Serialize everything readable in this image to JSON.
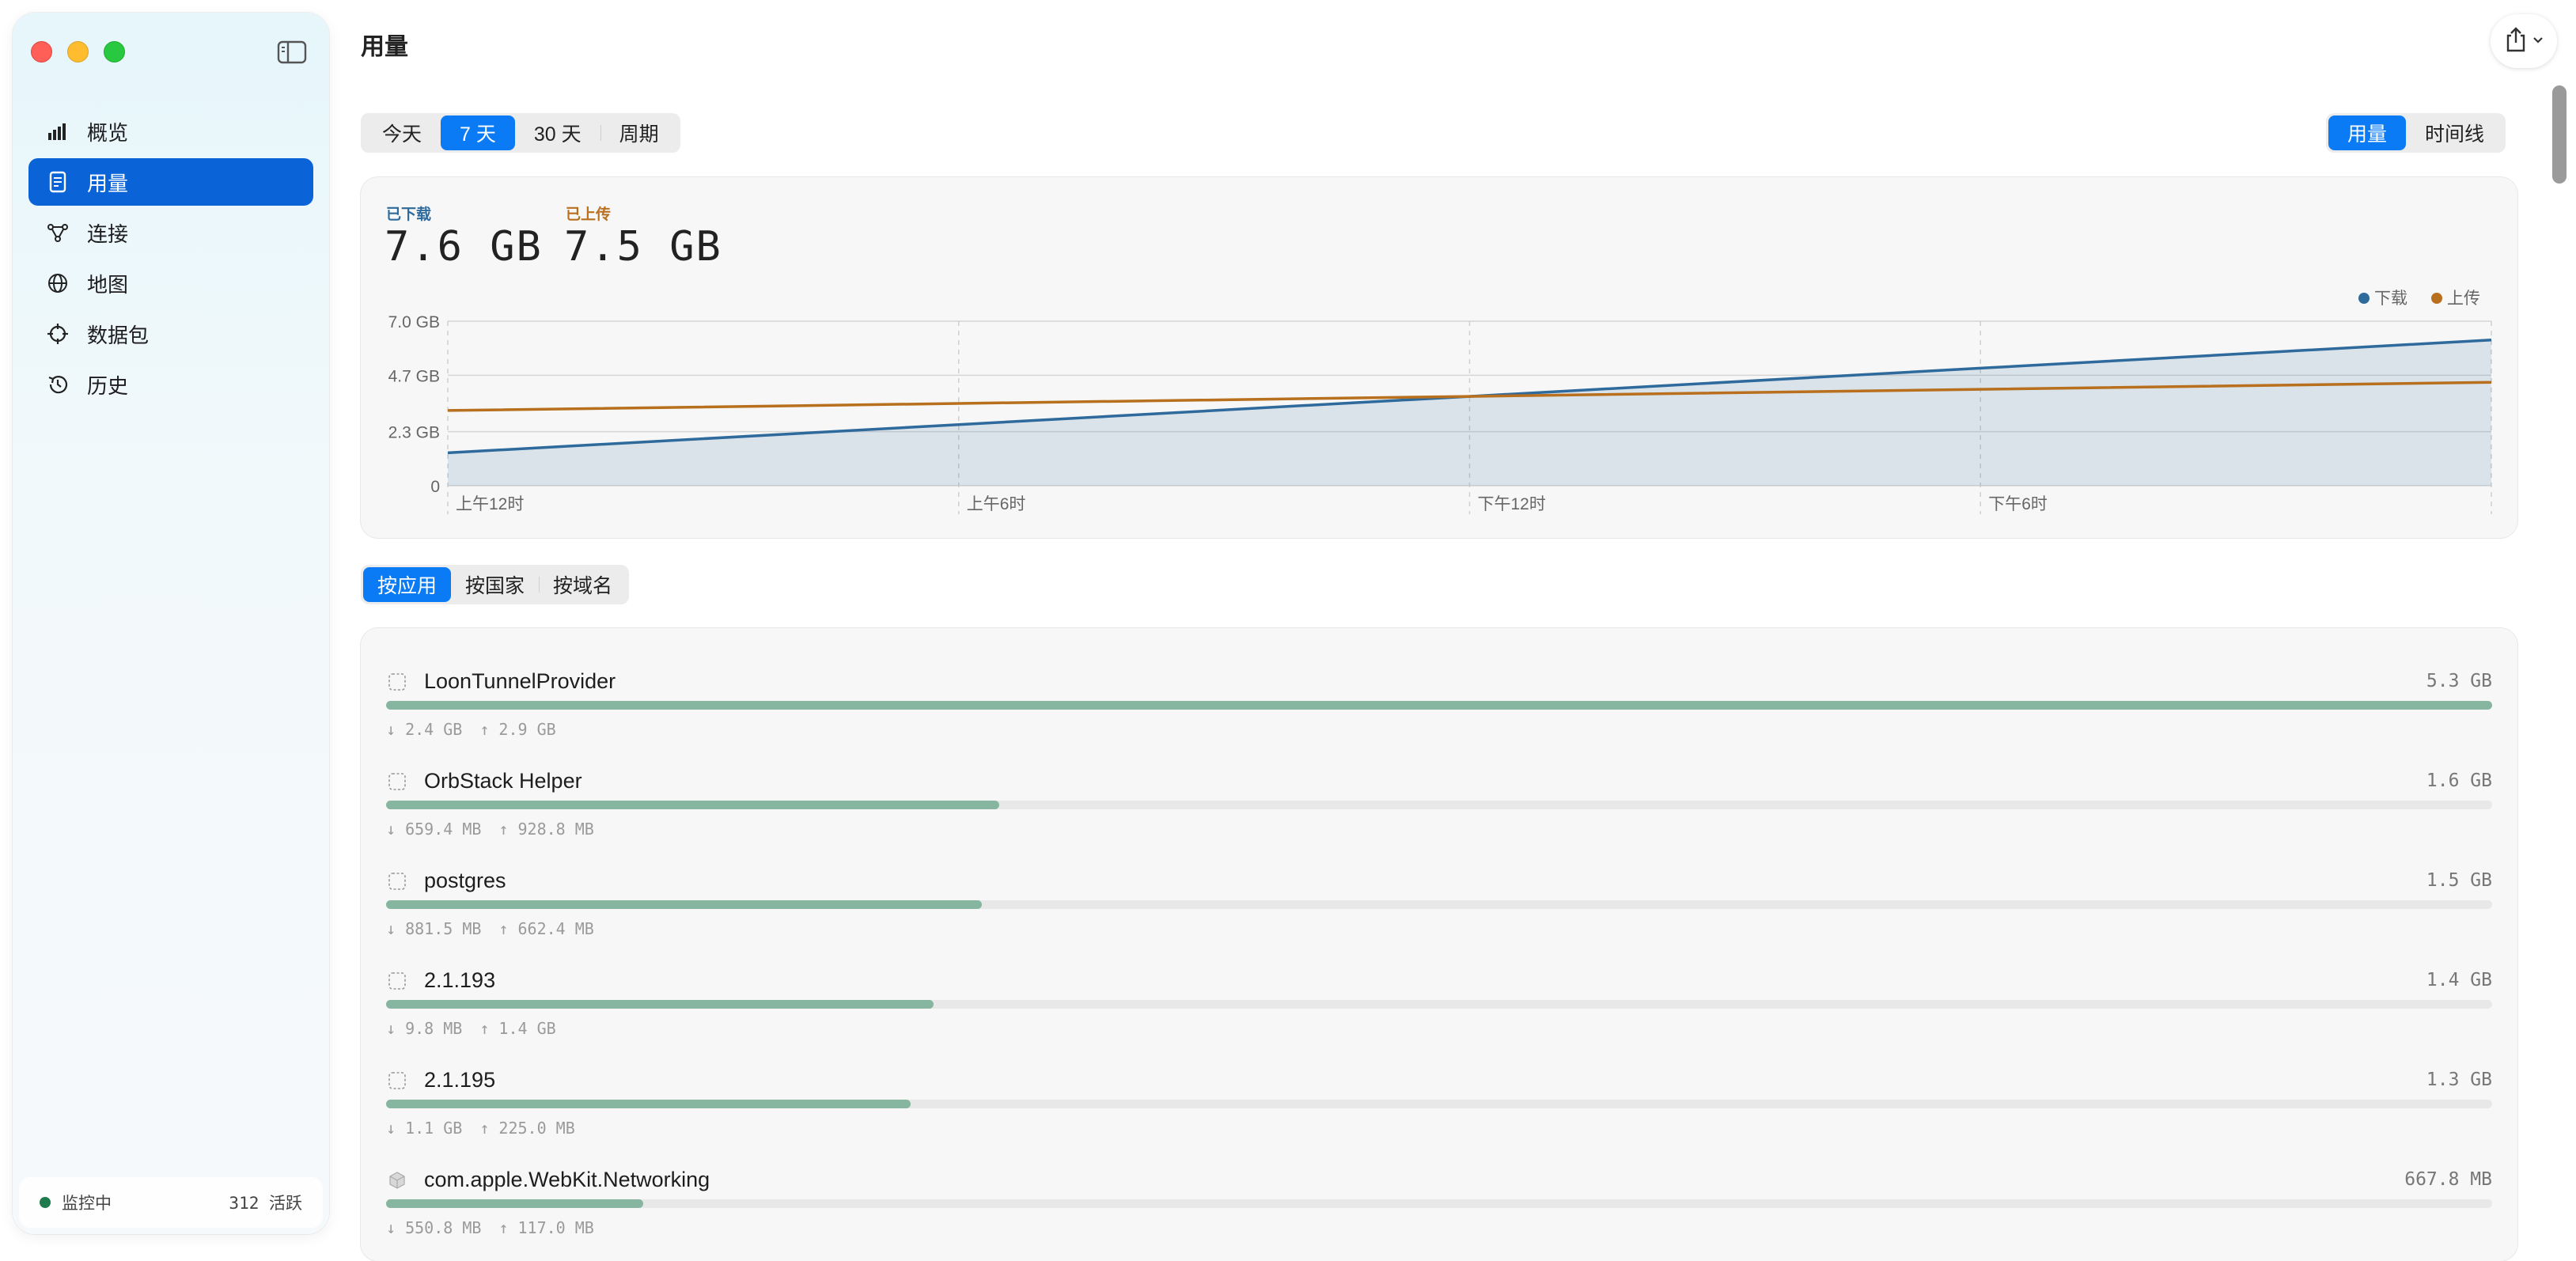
{
  "window": {
    "title": "用量"
  },
  "sidebar": {
    "items": [
      {
        "label": "概览",
        "icon": "chart-bars-icon"
      },
      {
        "label": "用量",
        "icon": "document-icon",
        "active": true
      },
      {
        "label": "连接",
        "icon": "nodes-icon"
      },
      {
        "label": "地图",
        "icon": "globe-icon"
      },
      {
        "label": "数据包",
        "icon": "crosshair-icon"
      },
      {
        "label": "历史",
        "icon": "history-icon"
      }
    ],
    "status": {
      "label": "监控中",
      "count": "312 活跃"
    }
  },
  "range_tabs": [
    {
      "label": "今天"
    },
    {
      "label": "7 天",
      "active": true
    },
    {
      "label": "30 天"
    },
    {
      "label": "周期"
    }
  ],
  "view_tabs": [
    {
      "label": "用量",
      "active": true
    },
    {
      "label": "时间线"
    }
  ],
  "summary": {
    "downloaded_label": "已下载",
    "downloaded_value": "7.6 GB",
    "uploaded_label": "已上传",
    "uploaded_value": "7.5 GB"
  },
  "colors": {
    "download": "#2f6a9c",
    "upload": "#b8701e",
    "accent": "#0a7bf5",
    "bar": "#86b5a0"
  },
  "chart_data": {
    "type": "area",
    "x": [
      "上午12时",
      "上午6时",
      "下午12时",
      "下午6时",
      ""
    ],
    "y_ticks": [
      "7.0 GB",
      "4.7 GB",
      "2.3 GB",
      "0"
    ],
    "y_tick_values": [
      7.0,
      4.7,
      2.3,
      0
    ],
    "ylim": [
      0,
      7.0
    ],
    "series": [
      {
        "name": "下载",
        "values": [
          1.4,
          2.6,
          3.8,
          5.0,
          6.2
        ]
      },
      {
        "name": "上传",
        "values": [
          3.2,
          3.5,
          3.8,
          4.1,
          4.4
        ]
      }
    ],
    "legend": "top-right",
    "grid": true
  },
  "group_tabs": [
    {
      "label": "按应用",
      "active": true
    },
    {
      "label": "按国家"
    },
    {
      "label": "按域名"
    }
  ],
  "apps": [
    {
      "name": "LoonTunnelProvider",
      "total": "5.3 GB",
      "down": "↓ 2.4 GB",
      "up": "↑ 2.9 GB",
      "share": 1.0
    },
    {
      "name": "OrbStack Helper",
      "total": "1.6 GB",
      "down": "↓ 659.4 MB",
      "up": "↑ 928.8 MB",
      "share": 0.291
    },
    {
      "name": "postgres",
      "total": "1.5 GB",
      "down": "↓ 881.5 MB",
      "up": "↑ 662.4 MB",
      "share": 0.283
    },
    {
      "name": "2.1.193",
      "total": "1.4 GB",
      "down": "↓ 9.8 MB",
      "up": "↑ 1.4 GB",
      "share": 0.26
    },
    {
      "name": "2.1.195",
      "total": "1.3 GB",
      "down": "↓ 1.1 GB",
      "up": "↑ 225.0 MB",
      "share": 0.249
    },
    {
      "name": "com.apple.WebKit.Networking",
      "total": "667.8 MB",
      "down": "↓ 550.8 MB",
      "up": "↑ 117.0 MB",
      "share": 0.122
    }
  ]
}
